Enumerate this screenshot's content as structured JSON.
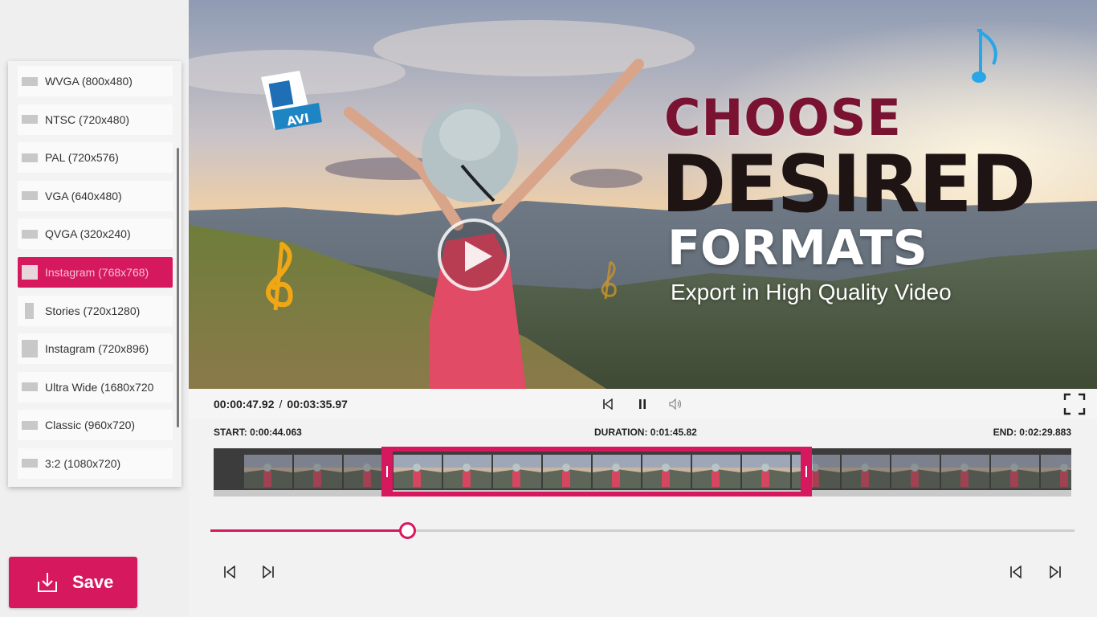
{
  "format_list": {
    "items": [
      {
        "label": "WVGA (800x480)",
        "shape": "wide",
        "active": false
      },
      {
        "label": "NTSC (720x480)",
        "shape": "wide",
        "active": false
      },
      {
        "label": "PAL (720x576)",
        "shape": "wide",
        "active": false
      },
      {
        "label": "VGA (640x480)",
        "shape": "wide",
        "active": false
      },
      {
        "label": "QVGA (320x240)",
        "shape": "wide",
        "active": false
      },
      {
        "label": "Instagram (768x768)",
        "shape": "square",
        "active": true
      },
      {
        "label": "Stories (720x1280)",
        "shape": "tall",
        "active": false
      },
      {
        "label": "Instagram (720x896)",
        "shape": "portrait",
        "active": false
      },
      {
        "label": "Ultra Wide (1680x720",
        "shape": "wide",
        "active": false
      },
      {
        "label": "Classic (960x720)",
        "shape": "wide",
        "active": false
      },
      {
        "label": "3:2 (1080x720)",
        "shape": "wide",
        "active": false
      }
    ]
  },
  "save_button": {
    "label": "Save",
    "icon": "download-icon"
  },
  "preview": {
    "promo": {
      "line1": "CHOOSE",
      "line2": "DESIRED",
      "line3": "FORMATS",
      "subtitle": "Export in High Quality Video"
    },
    "file_badge": "AVI"
  },
  "transport": {
    "current_time": "00:00:47.92",
    "separator": "/",
    "total_time": "00:03:35.97"
  },
  "trim": {
    "start_label": "START: 0:00:44.063",
    "duration_label": "DURATION: 0:01:45.82",
    "end_label": "END: 0:02:29.883"
  },
  "seek": {
    "progress_fraction": 0.228
  },
  "colors": {
    "accent": "#d6185f",
    "promo_red": "#7a1232",
    "promo_dark": "#1e1414"
  }
}
